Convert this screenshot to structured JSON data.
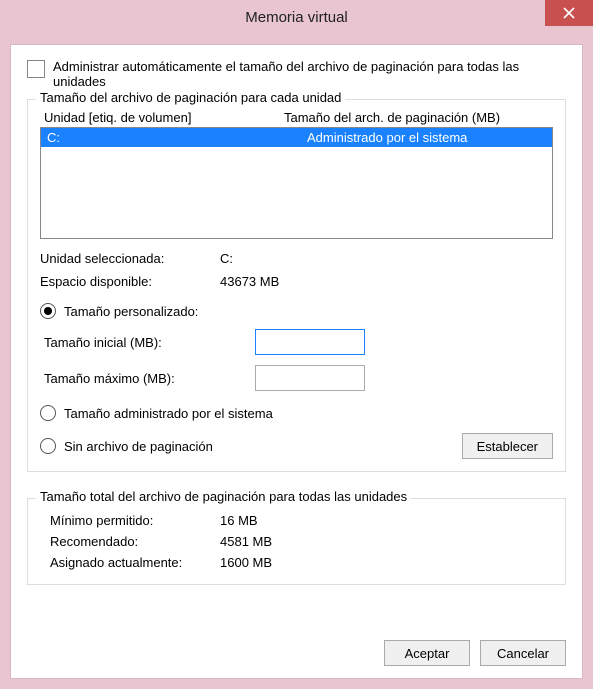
{
  "title": "Memoria virtual",
  "auto_manage_label": "Administrar automáticamente el tamaño del archivo de paginación para todas las unidades",
  "group1": {
    "title": "Tamaño del archivo de paginación para cada unidad",
    "col_drive": "Unidad [etiq. de volumen]",
    "col_size": "Tamaño del arch. de paginación (MB)",
    "rows": [
      {
        "drive": "C:",
        "size": "Administrado por el sistema"
      }
    ],
    "selected_drive_label": "Unidad seleccionada:",
    "selected_drive_value": "C:",
    "free_space_label": "Espacio disponible:",
    "free_space_value": "43673 MB",
    "radio_custom": "Tamaño personalizado:",
    "initial_label": "Tamaño inicial (MB):",
    "initial_value": "",
    "max_label": "Tamaño máximo (MB):",
    "max_value": "",
    "radio_system": "Tamaño administrado por el sistema",
    "radio_none": "Sin archivo de paginación",
    "set_button": "Establecer"
  },
  "group2": {
    "title": "Tamaño total del archivo de paginación para todas las unidades",
    "min_label": "Mínimo permitido:",
    "min_value": "16 MB",
    "rec_label": "Recomendado:",
    "rec_value": "4581 MB",
    "cur_label": "Asignado actualmente:",
    "cur_value": "1600 MB"
  },
  "buttons": {
    "ok": "Aceptar",
    "cancel": "Cancelar"
  }
}
